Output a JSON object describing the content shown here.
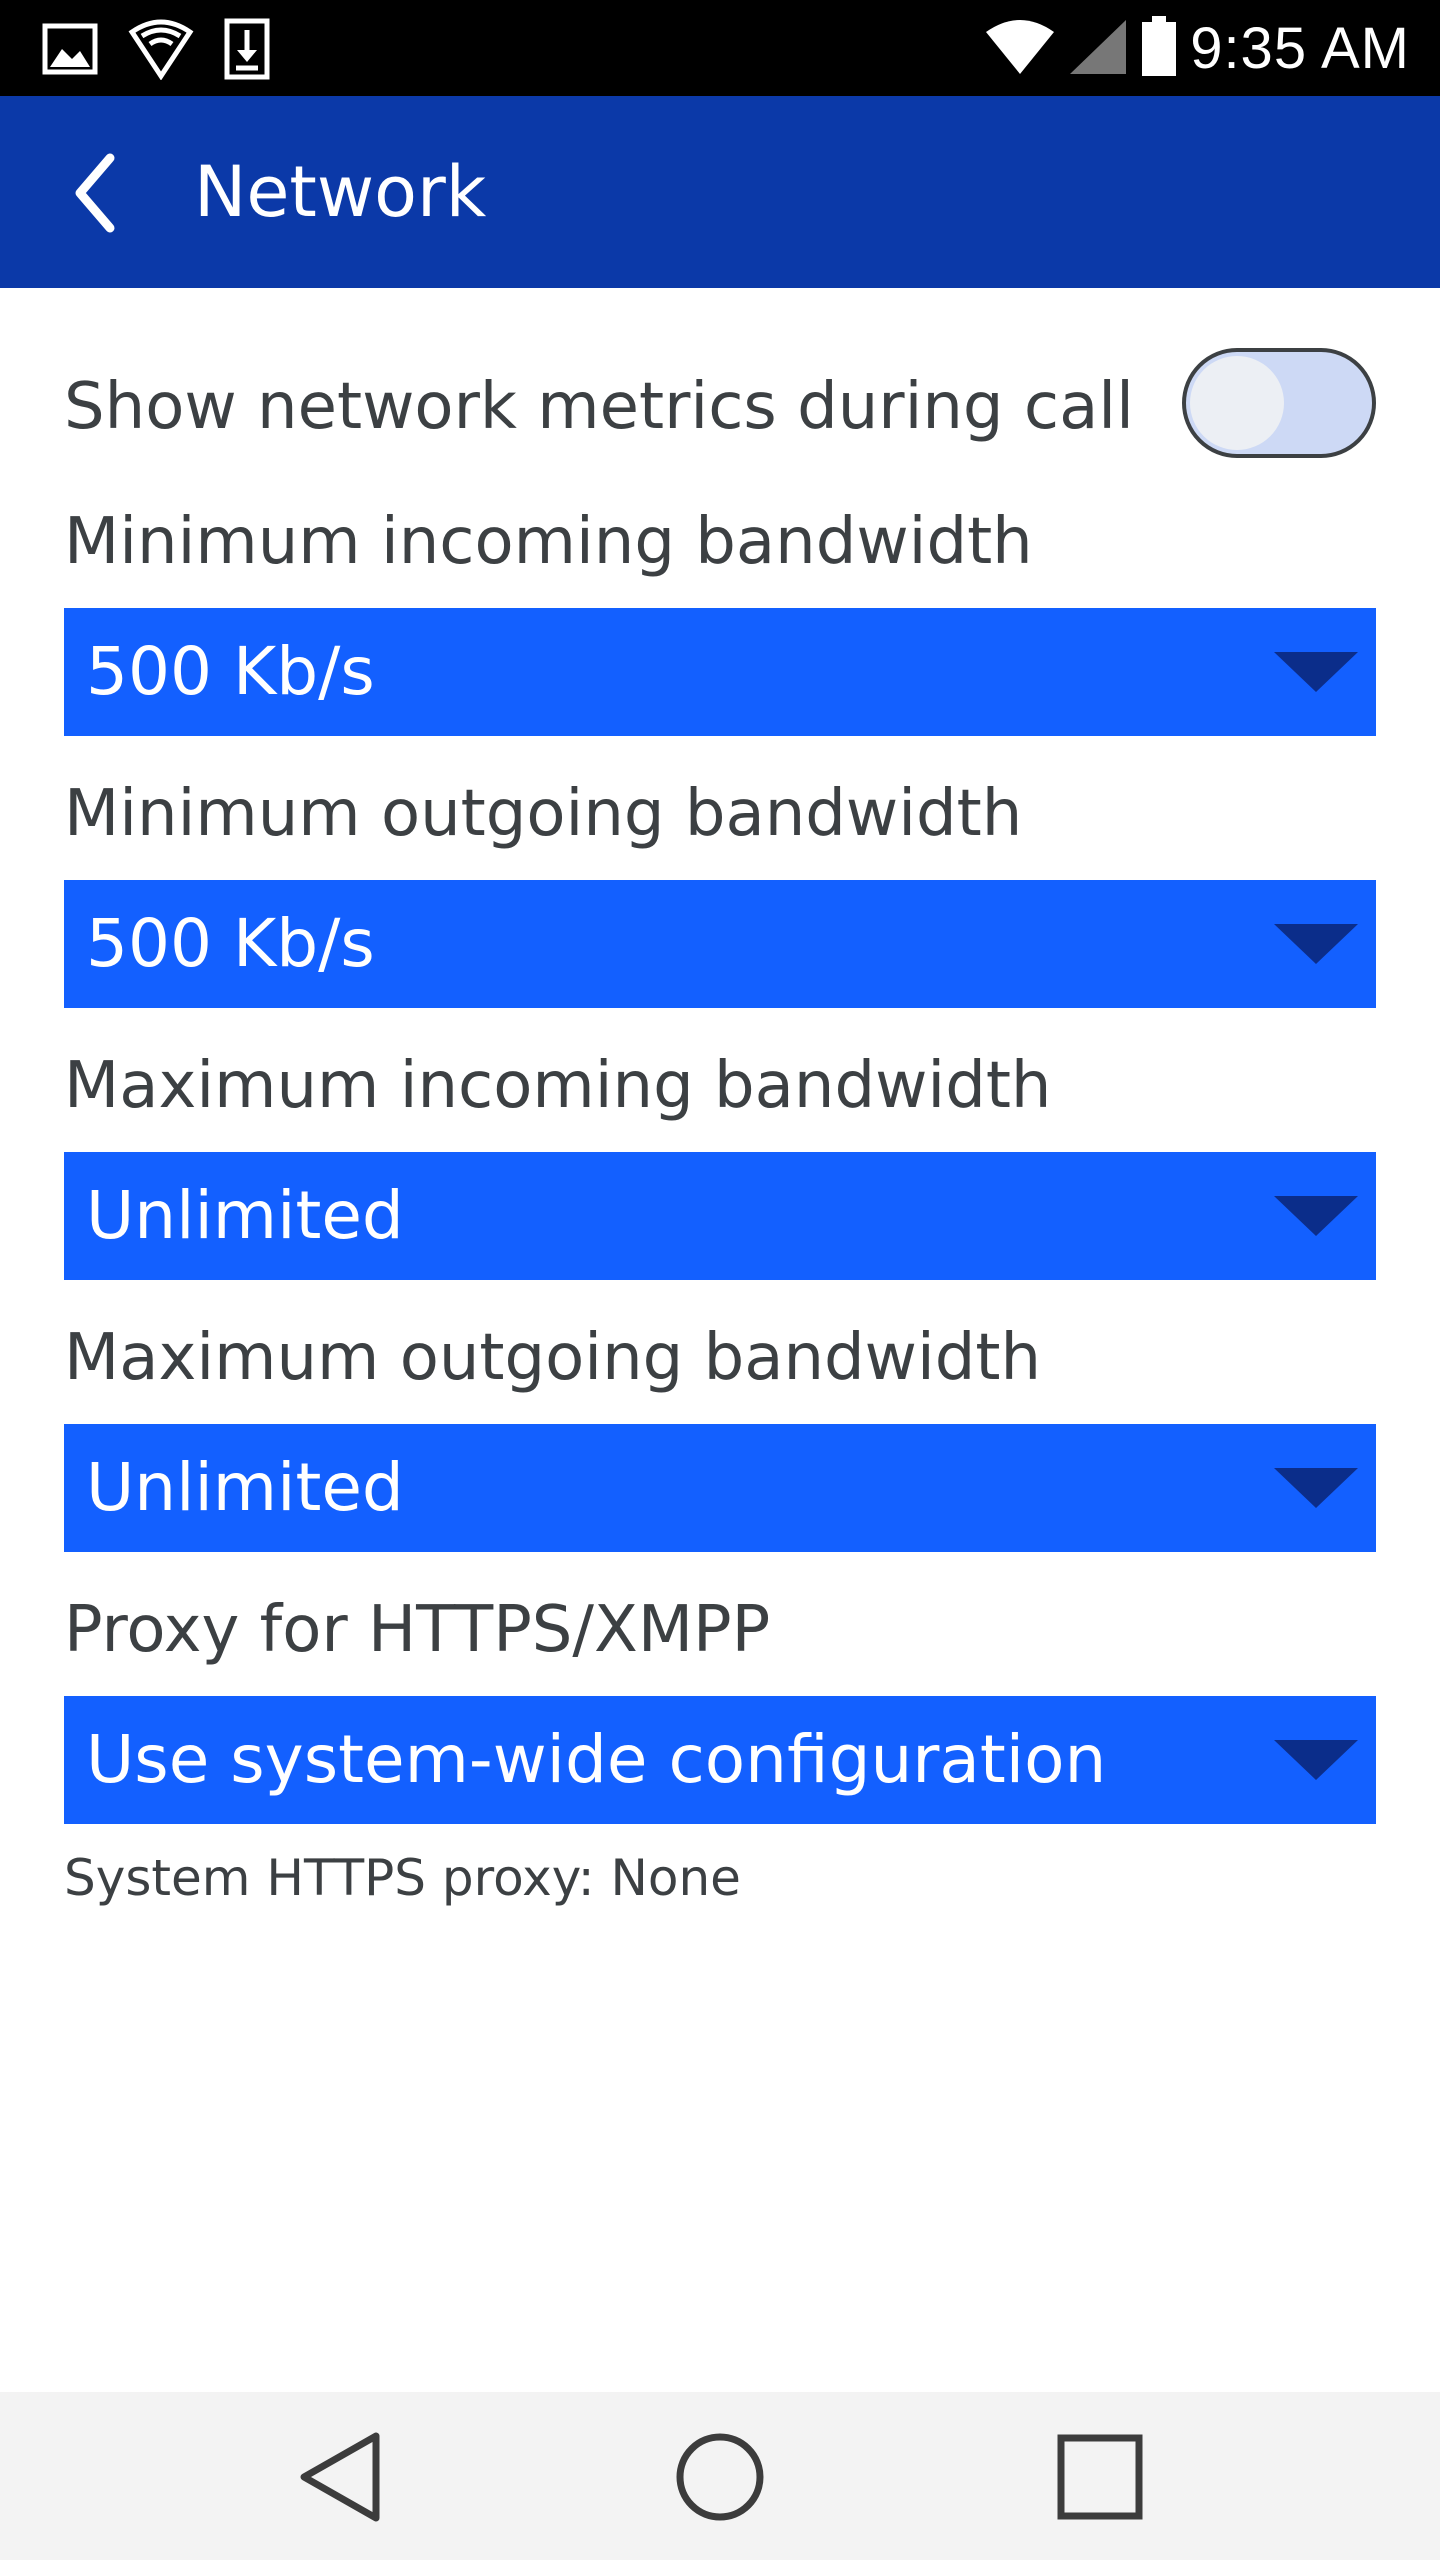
{
  "status_bar": {
    "time": "9:35 AM",
    "left_icons": [
      "image-icon",
      "shield-icon",
      "download-icon"
    ],
    "right_icons": [
      "wifi-icon",
      "signal-icon",
      "battery-icon"
    ]
  },
  "app_bar": {
    "title": "Network",
    "back_icon": "back-chevron-icon"
  },
  "settings": {
    "toggle": {
      "label": "Show network metrics during call",
      "state": "off"
    },
    "fields": [
      {
        "label": "Minimum incoming bandwidth",
        "value": "500 Kb/s"
      },
      {
        "label": "Minimum outgoing bandwidth",
        "value": "500 Kb/s"
      },
      {
        "label": "Maximum incoming bandwidth",
        "value": "Unlimited"
      },
      {
        "label": "Maximum outgoing bandwidth",
        "value": "Unlimited"
      },
      {
        "label": "Proxy for HTTPS/XMPP",
        "value": "Use system-wide configuration"
      }
    ],
    "hint": "System HTTPS proxy: None"
  },
  "nav_bar": {
    "buttons": [
      "nav-back-icon",
      "nav-home-icon",
      "nav-recents-icon"
    ]
  },
  "colors": {
    "app_bar": "#0b39a8",
    "select_bg": "#1360ff",
    "select_arrow": "#0b2d8a",
    "text": "#3c4043"
  }
}
